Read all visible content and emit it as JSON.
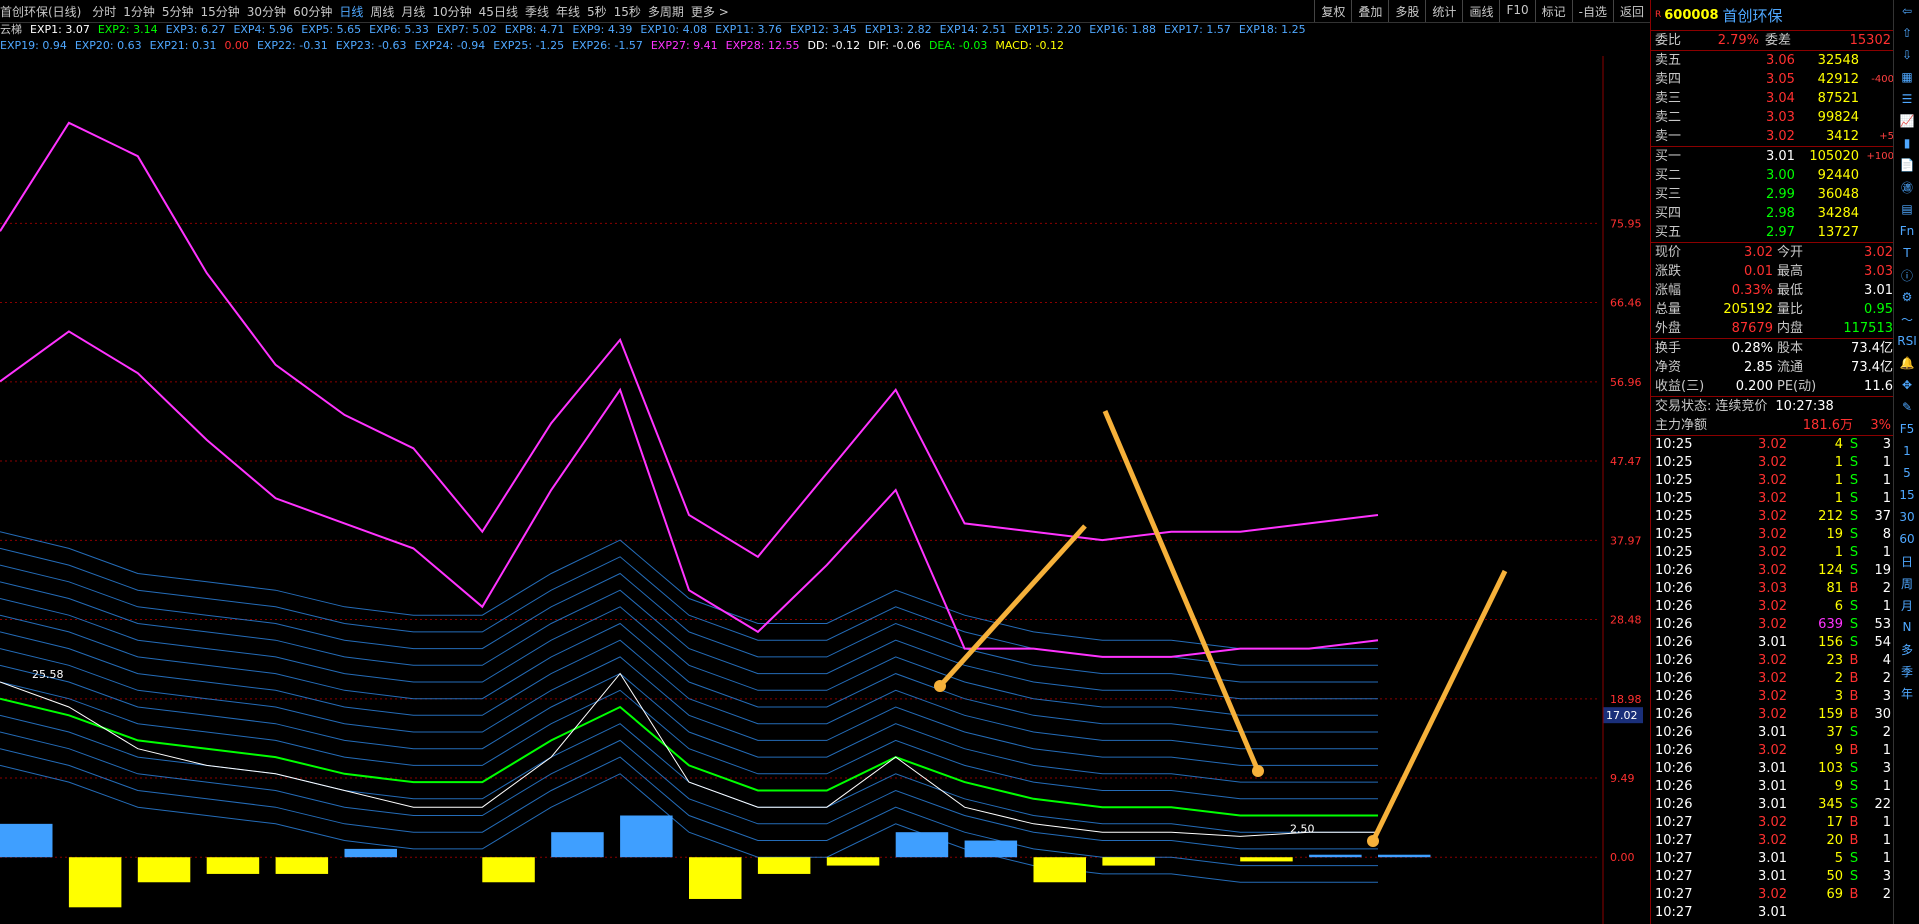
{
  "toolbar": {
    "app_title": "首创环保(日线)",
    "timeframes": [
      "分时",
      "1分钟",
      "5分钟",
      "15分钟",
      "30分钟",
      "60分钟",
      "日线",
      "周线",
      "月线",
      "10分钟",
      "45日线",
      "季线",
      "年线",
      "5秒",
      "15秒",
      "多周期",
      "更多 >"
    ],
    "active_timeframe": "日线",
    "actions": [
      "复权",
      "叠加",
      "多股",
      "统计",
      "画线",
      "F10",
      "标记",
      "-自选",
      "返回"
    ]
  },
  "indicators": {
    "row1": [
      {
        "text": "云梯",
        "color": "#c8c8c8"
      },
      {
        "text": "EXP1: 3.07",
        "color": "#ffffff"
      },
      {
        "text": "EXP2: 3.14",
        "color": "#00ff00"
      },
      {
        "text": "EXP3: 6.27",
        "color": "#4fa8ff"
      },
      {
        "text": "EXP4: 5.96",
        "color": "#4fa8ff"
      },
      {
        "text": "EXP5: 5.65",
        "color": "#4fa8ff"
      },
      {
        "text": "EXP6: 5.33",
        "color": "#4fa8ff"
      },
      {
        "text": "EXP7: 5.02",
        "color": "#4fa8ff"
      },
      {
        "text": "EXP8: 4.71",
        "color": "#4fa8ff"
      },
      {
        "text": "EXP9: 4.39",
        "color": "#4fa8ff"
      },
      {
        "text": "EXP10: 4.08",
        "color": "#4fa8ff"
      },
      {
        "text": "EXP11: 3.76",
        "color": "#4fa8ff"
      },
      {
        "text": "EXP12: 3.45",
        "color": "#4fa8ff"
      },
      {
        "text": "EXP13: 2.82",
        "color": "#4fa8ff"
      },
      {
        "text": "EXP14: 2.51",
        "color": "#4fa8ff"
      },
      {
        "text": "EXP15: 2.20",
        "color": "#4fa8ff"
      },
      {
        "text": "EXP16: 1.88",
        "color": "#4fa8ff"
      },
      {
        "text": "EXP17: 1.57",
        "color": "#4fa8ff"
      },
      {
        "text": "EXP18: 1.25",
        "color": "#4fa8ff"
      }
    ],
    "row2": [
      {
        "text": "EXP19: 0.94",
        "color": "#4fa8ff"
      },
      {
        "text": "EXP20: 0.63",
        "color": "#4fa8ff"
      },
      {
        "text": "EXP21: 0.31",
        "color": "#4fa8ff"
      },
      {
        "text": "0.00",
        "color": "#ff3030"
      },
      {
        "text": "EXP22: -0.31",
        "color": "#4fa8ff"
      },
      {
        "text": "EXP23: -0.63",
        "color": "#4fa8ff"
      },
      {
        "text": "EXP24: -0.94",
        "color": "#4fa8ff"
      },
      {
        "text": "EXP25: -1.25",
        "color": "#4fa8ff"
      },
      {
        "text": "EXP26: -1.57",
        "color": "#4fa8ff"
      },
      {
        "text": "EXP27: 9.41",
        "color": "#ff33ff"
      },
      {
        "text": "EXP28: 12.55",
        "color": "#ff33ff"
      },
      {
        "text": "DD: -0.12",
        "color": "#ffffff"
      },
      {
        "text": "DIF: -0.06",
        "color": "#ffffff"
      },
      {
        "text": "DEA: -0.03",
        "color": "#00ff00"
      },
      {
        "text": "MACD: -0.12",
        "color": "#ffff00"
      }
    ]
  },
  "chart_data": {
    "type": "line",
    "y_ticks": [
      "75.95",
      "66.46",
      "56.96",
      "47.47",
      "37.97",
      "28.48",
      "18.98",
      "9.49",
      "0.00"
    ],
    "ylim": [
      -8,
      96
    ],
    "price_tag": "17.02",
    "annotation_high": "25.58",
    "annotation_low": "2.50",
    "x": [
      0,
      5,
      10,
      15,
      20,
      25,
      30,
      35,
      40,
      45,
      50,
      55,
      60,
      65,
      70,
      75,
      80,
      85,
      90,
      95,
      100
    ],
    "series": [
      {
        "role": "upper-band",
        "color": "#ff33ff",
        "values": [
          75,
          88,
          84,
          70,
          59,
          53,
          49,
          39,
          52,
          62,
          41,
          36,
          46,
          56,
          40,
          39,
          38,
          39,
          39,
          40,
          41
        ]
      },
      {
        "role": "lower-band",
        "color": "#ff33ff",
        "values": [
          57,
          63,
          58,
          50,
          43,
          40,
          37,
          30,
          44,
          56,
          32,
          27,
          35,
          44,
          25,
          25,
          24,
          24,
          25,
          25,
          26
        ]
      },
      {
        "role": "central-line",
        "color": "#00ff00",
        "values": [
          19,
          17,
          14,
          13,
          12,
          10,
          9,
          9,
          14,
          18,
          11,
          8,
          8,
          12,
          9,
          7,
          6,
          6,
          5,
          5,
          5
        ]
      },
      {
        "role": "price",
        "color": "#ffffff",
        "values": [
          21,
          18,
          13,
          11,
          10,
          8,
          6,
          6,
          12,
          22,
          9,
          6,
          6,
          12,
          6,
          4,
          3,
          3,
          2.5,
          3,
          3
        ]
      }
    ],
    "cloud_offsets": [
      -8,
      -6,
      -4,
      -2,
      0,
      2,
      4,
      6,
      8,
      10,
      12,
      14,
      16,
      18,
      20
    ],
    "macd_x": [
      0,
      5,
      10,
      15,
      20,
      25,
      30,
      35,
      40,
      45,
      50,
      55,
      60,
      65,
      70,
      75,
      80,
      85,
      90,
      95,
      100
    ],
    "macd_values": [
      4,
      -6,
      -3,
      -2,
      -2,
      1,
      0,
      -3,
      3,
      5,
      -5,
      -2,
      -1,
      3,
      2,
      -3,
      -1,
      0,
      -0.5,
      0.3,
      0.3
    ]
  },
  "quote": {
    "code": "600008",
    "name": "首创环保",
    "weibi_label": "委比",
    "weibi_value": "2.79%",
    "weicha_label": "委差",
    "weicha_value": "15302",
    "asks": [
      {
        "label": "卖五",
        "price": "3.06",
        "vol": "32548",
        "chg": ""
      },
      {
        "label": "卖四",
        "price": "3.05",
        "vol": "42912",
        "chg": "-400"
      },
      {
        "label": "卖三",
        "price": "3.04",
        "vol": "87521",
        "chg": ""
      },
      {
        "label": "卖二",
        "price": "3.03",
        "vol": "99824",
        "chg": ""
      },
      {
        "label": "卖一",
        "price": "3.02",
        "vol": "3412",
        "chg": "+5"
      }
    ],
    "bids": [
      {
        "label": "买一",
        "price": "3.01",
        "vol": "105020",
        "chg": "+100"
      },
      {
        "label": "买二",
        "price": "3.00",
        "vol": "92440",
        "chg": ""
      },
      {
        "label": "买三",
        "price": "2.99",
        "vol": "36048",
        "chg": ""
      },
      {
        "label": "买四",
        "price": "2.98",
        "vol": "34284",
        "chg": ""
      },
      {
        "label": "买五",
        "price": "2.97",
        "vol": "13727",
        "chg": ""
      }
    ],
    "stats": [
      {
        "l1": "现价",
        "v1": "3.02",
        "c1": "#ff3030",
        "l2": "今开",
        "v2": "3.02",
        "c2": "#ff3030"
      },
      {
        "l1": "涨跌",
        "v1": "0.01",
        "c1": "#ff3030",
        "l2": "最高",
        "v2": "3.03",
        "c2": "#ff3030"
      },
      {
        "l1": "涨幅",
        "v1": "0.33%",
        "c1": "#ff3030",
        "l2": "最低",
        "v2": "3.01",
        "c2": "#ffffff"
      },
      {
        "l1": "总量",
        "v1": "205192",
        "c1": "#ffff00",
        "l2": "量比",
        "v2": "0.95",
        "c2": "#00ff00"
      },
      {
        "l1": "外盘",
        "v1": "87679",
        "c1": "#ff3030",
        "l2": "内盘",
        "v2": "117513",
        "c2": "#00ff00"
      }
    ],
    "stats2": [
      {
        "l1": "换手",
        "v1": "0.28%",
        "l2": "股本",
        "v2": "73.4亿"
      },
      {
        "l1": "净资",
        "v1": "2.85",
        "l2": "流通",
        "v2": "73.4亿"
      },
      {
        "l1": "收益(三)",
        "v1": "0.200",
        "l2": "PE(动)",
        "v2": "11.6"
      }
    ],
    "trade_status_label": "交易状态:",
    "trade_status": "连续竞价",
    "trade_time": "10:27:38",
    "net_label": "主力净额",
    "net_value": "181.6万",
    "net_pct": "3%"
  },
  "ticks": [
    {
      "t": "10:25",
      "p": "3.02",
      "v": "4",
      "d": "S",
      "n": "3"
    },
    {
      "t": "10:25",
      "p": "3.02",
      "v": "1",
      "d": "S",
      "n": "1"
    },
    {
      "t": "10:25",
      "p": "3.02",
      "v": "1",
      "d": "S",
      "n": "1"
    },
    {
      "t": "10:25",
      "p": "3.02",
      "v": "1",
      "d": "S",
      "n": "1"
    },
    {
      "t": "10:25",
      "p": "3.02",
      "v": "212",
      "d": "S",
      "n": "37"
    },
    {
      "t": "10:25",
      "p": "3.02",
      "v": "19",
      "d": "S",
      "n": "8"
    },
    {
      "t": "10:25",
      "p": "3.02",
      "v": "1",
      "d": "S",
      "n": "1"
    },
    {
      "t": "10:26",
      "p": "3.02",
      "v": "124",
      "d": "S",
      "n": "19"
    },
    {
      "t": "10:26",
      "p": "3.03",
      "v": "81",
      "d": "B",
      "n": "2"
    },
    {
      "t": "10:26",
      "p": "3.02",
      "v": "6",
      "d": "S",
      "n": "1"
    },
    {
      "t": "10:26",
      "p": "3.02",
      "v": "639",
      "d": "S",
      "n": "53"
    },
    {
      "t": "10:26",
      "p": "3.01",
      "v": "156",
      "d": "S",
      "n": "54"
    },
    {
      "t": "10:26",
      "p": "3.02",
      "v": "23",
      "d": "B",
      "n": "4"
    },
    {
      "t": "10:26",
      "p": "3.02",
      "v": "2",
      "d": "B",
      "n": "2"
    },
    {
      "t": "10:26",
      "p": "3.02",
      "v": "3",
      "d": "B",
      "n": "3"
    },
    {
      "t": "10:26",
      "p": "3.02",
      "v": "159",
      "d": "B",
      "n": "30"
    },
    {
      "t": "10:26",
      "p": "3.01",
      "v": "37",
      "d": "S",
      "n": "2"
    },
    {
      "t": "10:26",
      "p": "3.02",
      "v": "9",
      "d": "B",
      "n": "1"
    },
    {
      "t": "10:26",
      "p": "3.01",
      "v": "103",
      "d": "S",
      "n": "3"
    },
    {
      "t": "10:26",
      "p": "3.01",
      "v": "9",
      "d": "S",
      "n": "1"
    },
    {
      "t": "10:26",
      "p": "3.01",
      "v": "345",
      "d": "S",
      "n": "22"
    },
    {
      "t": "10:27",
      "p": "3.02",
      "v": "17",
      "d": "B",
      "n": "1"
    },
    {
      "t": "10:27",
      "p": "3.02",
      "v": "20",
      "d": "B",
      "n": "1"
    },
    {
      "t": "10:27",
      "p": "3.01",
      "v": "5",
      "d": "S",
      "n": "1"
    },
    {
      "t": "10:27",
      "p": "3.01",
      "v": "50",
      "d": "S",
      "n": "3"
    },
    {
      "t": "10:27",
      "p": "3.02",
      "v": "69",
      "d": "B",
      "n": "2"
    },
    {
      "t": "10:27",
      "p": "3.01",
      "v": "",
      "d": "",
      "n": ""
    }
  ],
  "sidebar_icons": [
    "back-icon",
    "up-arrow-icon",
    "down-arrow-icon",
    "grid-icon",
    "list-icon",
    "line-chart-icon",
    "candle-icon",
    "doc-icon",
    "fin-icon",
    "table-icon",
    "fn-icon",
    "text-icon",
    "info-icon",
    "settings-icon",
    "chart-icon",
    "rsi-icon",
    "bell-icon",
    "move-icon",
    "pencil-icon",
    "f5-icon",
    "one-icon",
    "five-icon",
    "fifteen-icon",
    "thirty-icon",
    "sixty-icon",
    "day-icon",
    "week-icon",
    "month-icon",
    "n-icon",
    "multi-icon",
    "season-icon",
    "year-icon"
  ],
  "sidebar_labels": [
    "⇦",
    "⇧",
    "⇩",
    "▦",
    "☰",
    "📈",
    "▮",
    "📄",
    "㊜",
    "▤",
    "Fn",
    "T",
    "ⓘ",
    "⚙",
    "〜",
    "RSI",
    "🔔",
    "✥",
    "✎",
    "F5",
    "1",
    "5",
    "15",
    "30",
    "60",
    "日",
    "周",
    "月",
    "N",
    "多",
    "季",
    "年"
  ]
}
